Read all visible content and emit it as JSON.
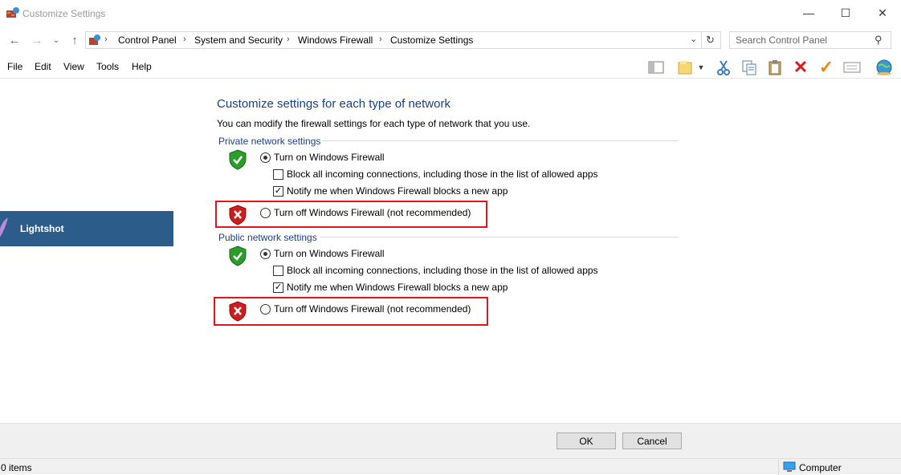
{
  "window": {
    "title": "Customize Settings"
  },
  "nav": {
    "breadcrumbs": [
      "Control Panel",
      "System and Security",
      "Windows Firewall",
      "Customize Settings"
    ],
    "search_placeholder": "Search Control Panel"
  },
  "menu": [
    "File",
    "Edit",
    "View",
    "Tools",
    "Help"
  ],
  "left_panel": {
    "item": "Lightshot"
  },
  "main": {
    "heading": "Customize settings for each type of network",
    "description": "You can modify the firewall settings for each type of network that you use.",
    "private": {
      "title": "Private network settings",
      "turn_on": "Turn on Windows Firewall",
      "block_all": "Block all incoming connections, including those in the list of allowed apps",
      "notify": "Notify me when Windows Firewall blocks a new app",
      "turn_off": "Turn off Windows Firewall (not recommended)"
    },
    "public": {
      "title": "Public network settings",
      "turn_on": "Turn on Windows Firewall",
      "block_all": "Block all incoming connections, including those in the list of allowed apps",
      "notify": "Notify me when Windows Firewall blocks a new app",
      "turn_off": "Turn off Windows Firewall (not recommended)"
    }
  },
  "buttons": {
    "ok": "OK",
    "cancel": "Cancel"
  },
  "status": {
    "items": "0 items",
    "computer": "Computer"
  },
  "colors": {
    "accent": "#1a3f8f",
    "highlight_border": "#e0161e",
    "lightshot_bg": "#2c5d8a"
  }
}
